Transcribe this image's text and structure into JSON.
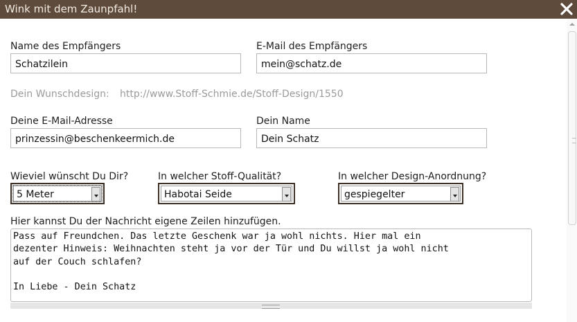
{
  "dialog": {
    "title": "Wink mit dem Zaunpfahl!",
    "close_icon": "close-x-icon"
  },
  "form": {
    "recipient_name": {
      "label": "Name des Empfängers",
      "value": "Schatzilein"
    },
    "recipient_email": {
      "label": "E-Mail des Empfängers",
      "value": "mein@schatz.de"
    },
    "wish_design": {
      "label": "Dein Wunschdesign:",
      "url": "http://www.Stoff-Schmie.de/Stoff-Design/1550"
    },
    "sender_email": {
      "label": "Deine E-Mail-Adresse",
      "value": "prinzessin@beschenkeermich.de"
    },
    "sender_name": {
      "label": "Dein Name",
      "value": "Dein Schatz"
    },
    "quantity": {
      "label": "Wieviel wünscht Du Dir?",
      "value": "5 Meter"
    },
    "quality": {
      "label": "In welcher Stoff-Qualität?",
      "value": "Habotai Seide"
    },
    "arrangement": {
      "label": "In welcher Design-Anordnung?",
      "value": "gespiegelter"
    },
    "message": {
      "label": "Hier kannst Du der Nachricht eigene Zeilen hinzufügen.",
      "value": "Pass auf Freundchen. Das letzte Geschenk war ja wohl nichts. Hier mal ein\ndezenter Hinweis: Weihnachten steht ja vor der Tür und Du willst ja wohl nicht\nauf der Couch schlafen?\n\nIn Liebe - Dein Schatz"
    }
  },
  "colors": {
    "titlebar": "#5e4b3c",
    "title_text": "#f3ece4",
    "muted_text": "#9a9a9a"
  }
}
